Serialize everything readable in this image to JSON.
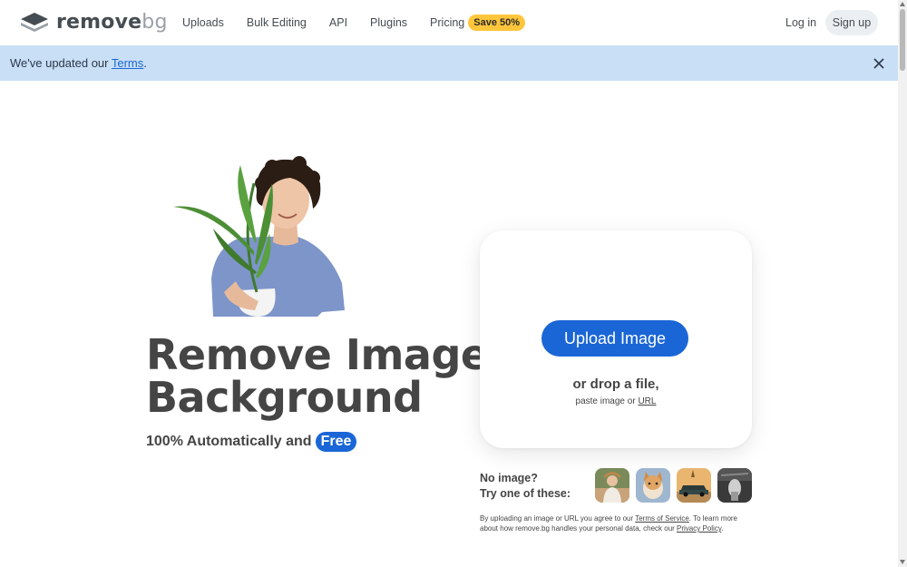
{
  "header": {
    "logo_text": "remove",
    "logo_text_suffix": "bg",
    "nav": {
      "uploads": "Uploads",
      "bulk_editing": "Bulk Editing",
      "api": "API",
      "plugins": "Plugins",
      "pricing": "Pricing"
    },
    "save_badge": "Save 50%",
    "login": "Log in",
    "signup": "Sign up"
  },
  "banner": {
    "text_before": "We've updated our ",
    "link_text": "Terms",
    "text_after": "."
  },
  "hero": {
    "headline_line1": "Remove Image",
    "headline_line2": "Background",
    "subline": "100% Automatically and",
    "free_label": "Free"
  },
  "upload_card": {
    "upload_button": "Upload Image",
    "drop_text": "or drop a file,",
    "paste_text": "paste image or",
    "url_link": "URL"
  },
  "samples": {
    "line1": "No image?",
    "line2": "Try one of these:",
    "items": [
      "sample-woman",
      "sample-dog",
      "sample-car",
      "sample-product"
    ]
  },
  "legal": {
    "part1": "By uploading an image or URL you agree to our ",
    "tos_link": "Terms of Service",
    "part2": ". To learn more about how remove.bg handles your personal data, check our ",
    "privacy_link": "Privacy Policy",
    "part3": "."
  },
  "colors": {
    "accent": "#1a66d6",
    "banner_bg": "#c8dff6",
    "badge": "#ffc63c"
  }
}
